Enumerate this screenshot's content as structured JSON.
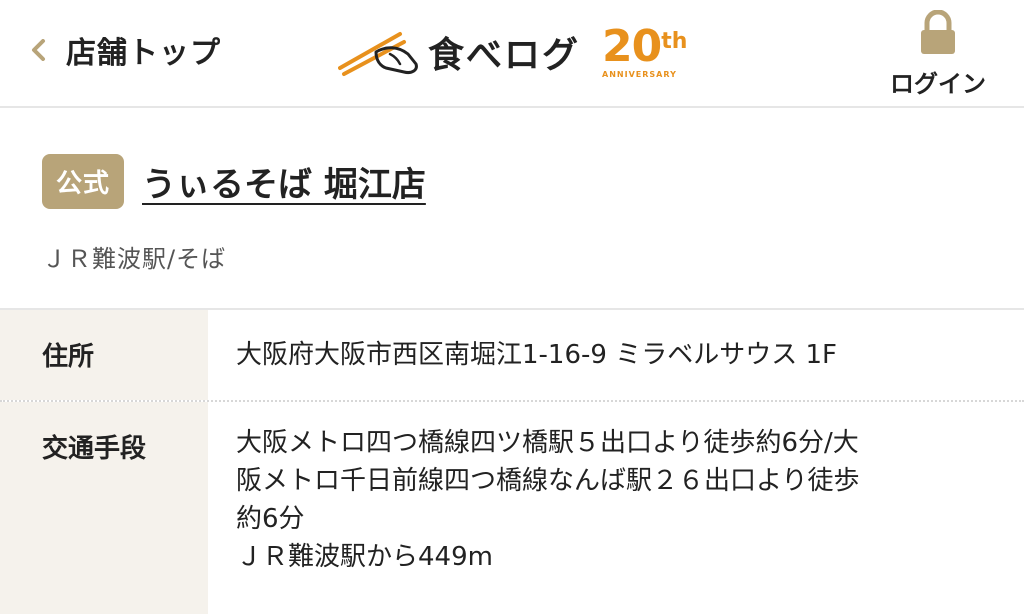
{
  "header": {
    "back_label": "店舗トップ",
    "logo_text": "食べログ",
    "anniversary_number": "20",
    "anniversary_suffix": "th",
    "anniversary_sub": "ANNIVERSARY",
    "login_label": "ログイン"
  },
  "shop": {
    "badge": "公式",
    "name": "うぃるそば 堀江店",
    "subtitle": "ＪＲ難波駅/そば"
  },
  "info": {
    "address_label": "住所",
    "address_value": "大阪府大阪市西区南堀江1-16-9 ミラベルサウス 1F",
    "transport_label": "交通手段",
    "transport_lines": [
      "大阪メトロ四つ橋線四ツ橋駅５出口より徒歩約6分/大",
      "阪メトロ千日前線四つ橋線なんば駅２６出口より徒歩",
      "約6分",
      "ＪＲ難波駅から449m"
    ]
  },
  "colors": {
    "accent_gold": "#b8a479",
    "brand_orange": "#e8911d",
    "key_bg": "#f5f2ec"
  },
  "icons": {
    "back": "chevron-left-icon",
    "logo": "chopsticks-hand-icon",
    "login": "lock-icon"
  }
}
